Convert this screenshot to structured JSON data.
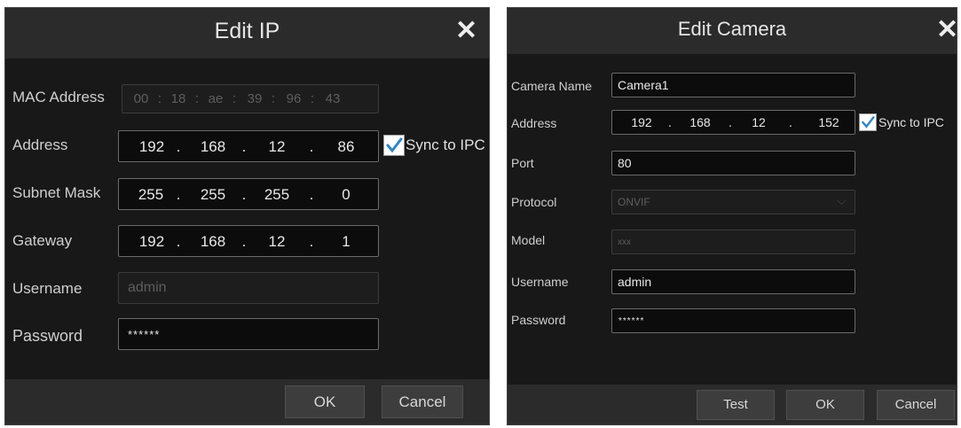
{
  "edit_ip": {
    "title": "Edit IP",
    "close_glyph": "✕",
    "mac_label": "MAC Address",
    "mac_octets": [
      "00",
      "18",
      "ae",
      "39",
      "96",
      "43"
    ],
    "mac_sep": ":",
    "address_label": "Address",
    "address_octets": [
      "192",
      "168",
      "12",
      "86"
    ],
    "ip_sep": ".",
    "sync_label": "Sync to IPC",
    "subnet_label": "Subnet Mask",
    "subnet_octets": [
      "255",
      "255",
      "255",
      "0"
    ],
    "gateway_label": "Gateway",
    "gateway_octets": [
      "192",
      "168",
      "12",
      "1"
    ],
    "username_label": "Username",
    "username_value": "admin",
    "password_label": "Password",
    "password_value": "******",
    "ok_label": "OK",
    "cancel_label": "Cancel"
  },
  "edit_camera": {
    "title": "Edit Camera",
    "close_glyph": "✕",
    "camera_name_label": "Camera Name",
    "camera_name_value": "Camera1",
    "address_label": "Address",
    "address_octets": [
      "192",
      "168",
      "12",
      "152"
    ],
    "ip_sep": ".",
    "sync_label": "Sync to IPC",
    "port_label": "Port",
    "port_value": "80",
    "protocol_label": "Protocol",
    "protocol_value": "ONVIF",
    "model_label": "Model",
    "model_value": "xxx",
    "username_label": "Username",
    "username_value": "admin",
    "password_label": "Password",
    "password_value": "******",
    "test_label": "Test",
    "ok_label": "OK",
    "cancel_label": "Cancel"
  },
  "colors": {
    "dialog_bg": "#181818",
    "titlebar_bg": "#2b2b2b",
    "checkbox_check": "#2f86c6"
  }
}
